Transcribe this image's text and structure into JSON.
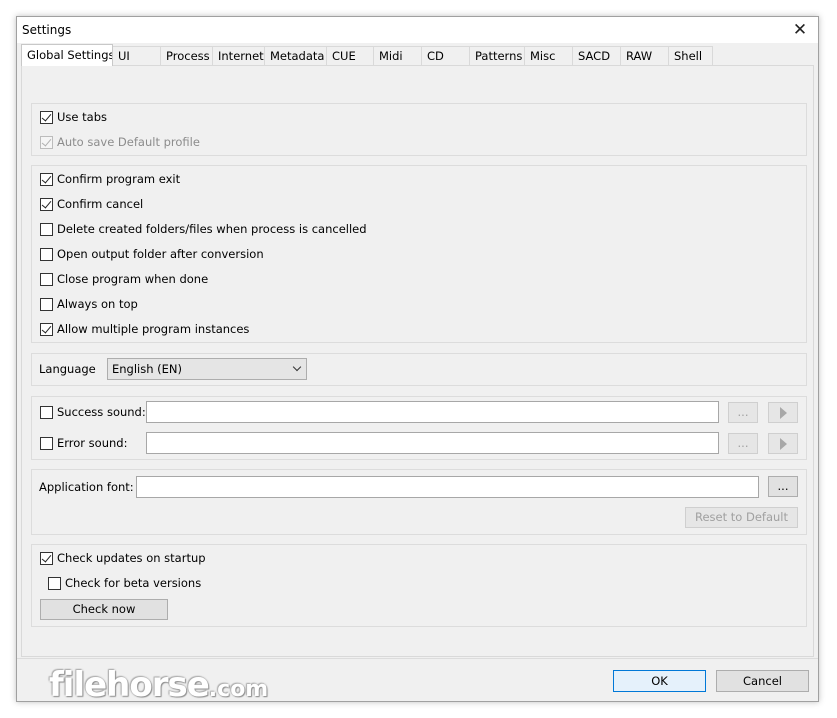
{
  "window": {
    "title": "Settings"
  },
  "tabs": [
    {
      "label": "Global Settings",
      "active": true
    },
    {
      "label": "UI"
    },
    {
      "label": "Process"
    },
    {
      "label": "Internet"
    },
    {
      "label": "Metadata"
    },
    {
      "label": "CUE"
    },
    {
      "label": "Midi"
    },
    {
      "label": "CD"
    },
    {
      "label": "Patterns"
    },
    {
      "label": "Misc"
    },
    {
      "label": "SACD"
    },
    {
      "label": "RAW"
    },
    {
      "label": "Shell"
    }
  ],
  "group_tabs": {
    "use_tabs": {
      "label": "Use tabs",
      "checked": true
    },
    "auto_save": {
      "label": "Auto save Default profile",
      "checked": true,
      "disabled": true
    }
  },
  "group_program": {
    "confirm_exit": {
      "label": "Confirm program exit",
      "checked": true
    },
    "confirm_cancel": {
      "label": "Confirm cancel",
      "checked": true
    },
    "delete_created": {
      "label": "Delete created folders/files when process is cancelled",
      "checked": false
    },
    "open_output": {
      "label": "Open output folder after conversion",
      "checked": false
    },
    "close_when_done": {
      "label": "Close program when done",
      "checked": false
    },
    "always_on_top": {
      "label": "Always on top",
      "checked": false
    },
    "multiple_instances": {
      "label": "Allow multiple program instances",
      "checked": true
    }
  },
  "language": {
    "label": "Language",
    "value": "English (EN)"
  },
  "sounds": {
    "success": {
      "label": "Success sound:",
      "checked": false,
      "value": ""
    },
    "error": {
      "label": "Error sound:",
      "checked": false,
      "value": ""
    },
    "browse_label": "...",
    "play_icon": "play-icon"
  },
  "font": {
    "label": "Application font:",
    "value": "",
    "browse_label": "...",
    "reset_label": "Reset to Default"
  },
  "updates": {
    "check_on_startup": {
      "label": "Check updates on startup",
      "checked": true
    },
    "beta": {
      "label": "Check for beta versions",
      "checked": false
    },
    "check_now_label": "Check now"
  },
  "footer": {
    "ok_label": "OK",
    "cancel_label": "Cancel"
  },
  "watermark": {
    "brand": "filehorse",
    "tld": ".com"
  },
  "colors": {
    "accent": "#0078d7",
    "window_bg": "#f0f0f0"
  }
}
